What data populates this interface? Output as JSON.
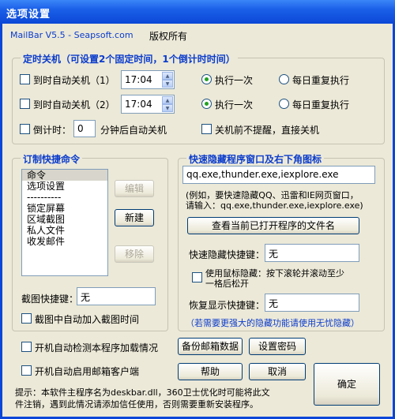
{
  "window": {
    "title": "选项设置"
  },
  "header": {
    "app_name": "MailBar V5.5 - Seapsoft.com",
    "copyright": "版权所有"
  },
  "shutdown": {
    "legend": "定时关机（可设置2个固定时间，1个倒计时时间）",
    "row1_label": "到时自动关机（1）",
    "row1_time": "17:04",
    "row1_once": "执行一次",
    "row1_daily": "每日重复执行",
    "row2_label": "到时自动关机（2）",
    "row2_time": "17:04",
    "row2_once": "执行一次",
    "row2_daily": "每日重复执行",
    "countdown_label": "倒计时：",
    "countdown_value": "0",
    "countdown_suffix": "分钟后自动关机",
    "no_remind_label": "关机前不提醒，直接关机"
  },
  "commands": {
    "legend": "订制快捷命令",
    "items": [
      "命令",
      "选项设置",
      "----------",
      "锁定屏幕",
      "区域截图",
      "私人文件",
      "收发邮件"
    ],
    "edit_button": "编辑",
    "new_button": "新建",
    "remove_button": "移除",
    "screenshot_hotkey_label": "截图快捷键：",
    "screenshot_hotkey_value": "无",
    "add_time_label": "截图中自动加入截图时间"
  },
  "hide": {
    "legend": "快速隐藏程序窗口及右下角图标",
    "programs_value": "qq.exe,thunder.exe,iexplore.exe",
    "example_line1": "(例如，要快速隐藏QQ、迅雷和IE网页窗口，",
    "example_line2": "请输入：qq.exe,thunder.exe,iexplore.exe)",
    "view_button": "查看当前已打开程序的文件名",
    "hide_hotkey_label": "快速隐藏快捷键：",
    "hide_hotkey_value": "无",
    "mouse_hide_line1": "使用鼠标隐藏：按下滚轮并滚动至少",
    "mouse_hide_line2": "一格后松开",
    "restore_hotkey_label": "恢复显示快捷键：",
    "restore_hotkey_value": "无",
    "note": "（若需要更强大的隐藏功能请使用无忧隐藏）"
  },
  "bottom": {
    "autocheck_label": "开机自动检测本程序加载情况",
    "autostart_label": "开机自动启用邮箱客户端",
    "backup_button": "备份邮箱数据",
    "password_button": "设置密码",
    "help_button": "帮助",
    "cancel_button": "取消",
    "ok_button": "确定",
    "tip_line1": "提示：本软件主程序名为deskbar.dll，360卫士优化时可能将此文",
    "tip_line2": "件注销，遇到此情况请添加信任使用，否则需要重新安装程序。"
  }
}
